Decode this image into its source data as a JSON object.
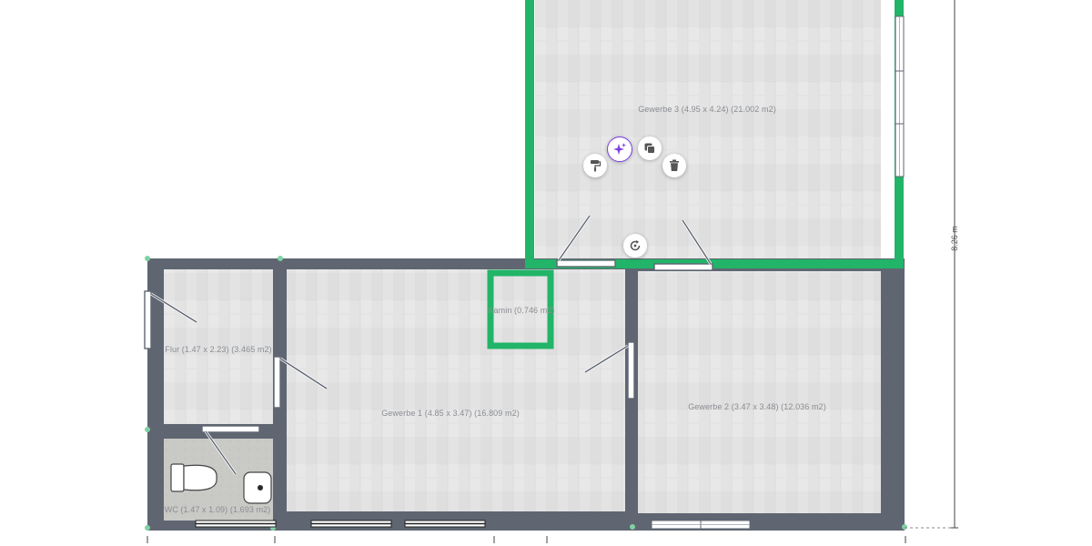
{
  "rooms": {
    "gewerbe3": "Gewerbe 3 (4.95 x 4.24) (21.002 m2)",
    "kamin": "Kamin (0.746 m2)",
    "flur": "Flur (1.47 x 2.23) (3.465 m2)",
    "gewerbe1": "Gewerbe 1 (4.85 x 3.47) (16.809 m2)",
    "gewerbe2": "Gewerbe 2 (3.47 x 3.48) (12.036 m2)",
    "wc": "WC (1.47 x 1.09) (1.693 m2)"
  },
  "dimension": {
    "height": "8.26 m"
  },
  "toolbar": {
    "paint": "paint-roller-icon",
    "ai": "sparkle-icon",
    "duplicate": "duplicate-icon",
    "delete": "trash-icon",
    "rotate": "rotate-icon"
  },
  "colors": {
    "selection": "#22b468",
    "wall": "#5f6672",
    "accent": "#7b3fe4"
  }
}
